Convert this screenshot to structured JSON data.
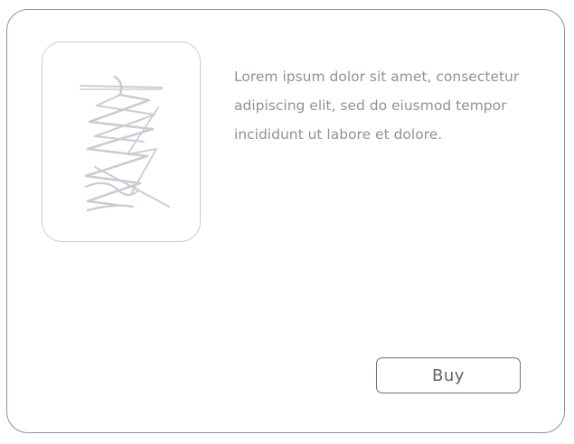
{
  "product": {
    "image_icon": "image-placeholder-scribble-icon",
    "description": "Lorem ipsum dolor sit amet, consectetur adipiscing elit, sed do eiusmod tempor incididunt ut labore et dolore.",
    "buy_label": "Buy"
  },
  "colors": {
    "card_border": "#8f949b",
    "image_border": "#c8ccd1",
    "scribble": "#c9cdd2",
    "text": "#8e939a",
    "button_border": "#6d7279",
    "button_text": "#5f646b"
  }
}
